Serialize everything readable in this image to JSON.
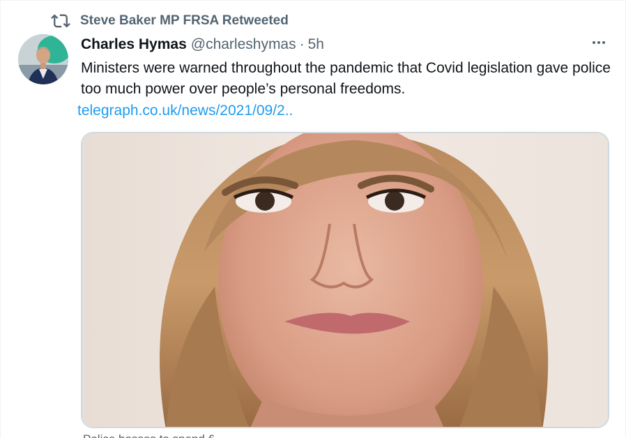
{
  "retweet": {
    "label": "Steve Baker MP FRSA Retweeted",
    "icon": "retweet-icon"
  },
  "tweet": {
    "display_name": "Charles Hymas",
    "handle": "@charleshymas",
    "separator": "·",
    "timestamp": "5h",
    "text": "Ministers were warned throughout the pandemic that Covid legislation gave police too much power over people’s personal freedoms.",
    "link": "telegraph.co.uk/news/2021/09/2..",
    "more_icon": "more-horizontal-icon"
  },
  "card": {
    "caption": "Police bosses to spend ₤ ..."
  },
  "colors": {
    "text_primary": "#0f1419",
    "text_secondary": "#536471",
    "link": "#1d9bf0",
    "border": "#cfd9de"
  }
}
